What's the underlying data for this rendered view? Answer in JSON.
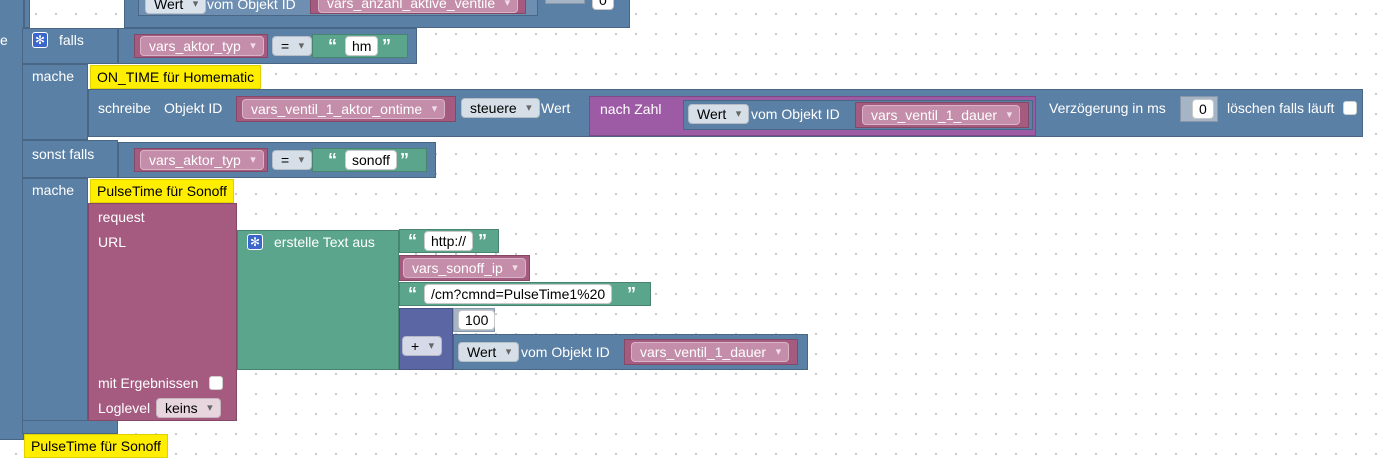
{
  "top_block": {
    "wert_dropdown": "Wert",
    "vom_objekt_id": "vom Objekt ID",
    "var": "vars_anzahl_aktive_ventile",
    "value": "0"
  },
  "if_block": {
    "cut_label": "e",
    "falls": "falls",
    "mache": "mache",
    "sonst_falls": "sonst falls",
    "condition1": {
      "var": "vars_aktor_typ",
      "op": "=",
      "text": "hm"
    },
    "condition2": {
      "var": "vars_aktor_typ",
      "op": "=",
      "text": "sonoff"
    }
  },
  "comment1": "ON_TIME für Homematic",
  "write_block": {
    "schreibe": "schreibe",
    "objekt_id": "Objekt ID",
    "var": "vars_ventil_1_aktor_ontime",
    "steuere": "steuere",
    "wert": "Wert",
    "nach_zahl": "nach Zahl",
    "wert_dropdown": "Wert",
    "vom_objekt_id": "vom Objekt ID",
    "dauer_var": "vars_ventil_1_dauer",
    "verzoegerung": "Verzögerung in ms",
    "delay_value": "0",
    "loeschen": "löschen falls läuft"
  },
  "comment2": "PulseTime für Sonoff",
  "request_block": {
    "request": "request",
    "url": "URL",
    "mit_ergebnissen": "mit Ergebnissen",
    "loglevel": "Loglevel",
    "loglevel_value": "keins"
  },
  "text_join": {
    "label": "erstelle Text aus",
    "text1": "http://",
    "var_ip": "vars_sonoff_ip",
    "text2": "/cm?cmnd=PulseTime1%20",
    "op": "+",
    "num": "100",
    "wert_dropdown": "Wert",
    "vom_objekt_id": "vom Objekt ID",
    "dauer_var": "vars_ventil_1_dauer"
  },
  "comment3": "PulseTime für Sonoff",
  "colors": {
    "control": "#5b80a5",
    "variable": "#a55b80",
    "text": "#5ba58c",
    "math": "#5b67a5",
    "convert": "#9e5ba5",
    "comment": "#ffee00"
  }
}
